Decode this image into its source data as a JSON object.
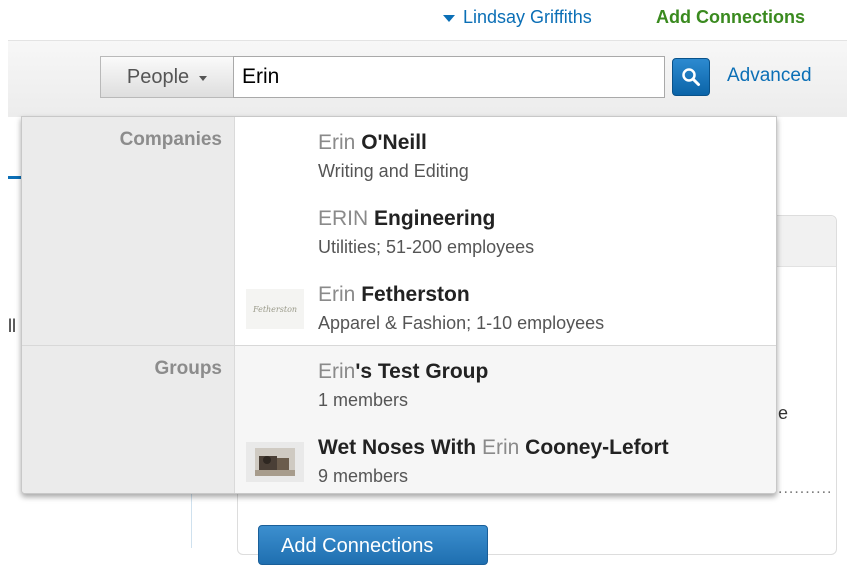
{
  "header": {
    "user_name": "Lindsay Griffiths",
    "add_connections": "Add Connections"
  },
  "search": {
    "scope_label": "People",
    "query": "Erin",
    "advanced_label": "Advanced"
  },
  "background": {
    "add_connections_button": "Add Connections"
  },
  "dropdown": {
    "companies_label": "Companies",
    "groups_label": "Groups",
    "companies": [
      {
        "highlight": "Erin",
        "rest": " O'Neill",
        "subtitle": "Writing and Editing",
        "thumb": ""
      },
      {
        "highlight": "ERIN",
        "rest": " Engineering",
        "subtitle": "Utilities; 51-200 employees",
        "thumb": ""
      },
      {
        "highlight": "Erin",
        "rest": " Fetherston",
        "subtitle": "Apparel & Fashion; 1-10 employees",
        "thumb": "Fetherston"
      }
    ],
    "groups": [
      {
        "prefix": "",
        "highlight": "Erin",
        "rest": "'s Test Group",
        "subtitle": "1 members"
      },
      {
        "prefix": "Wet Noses With ",
        "highlight": "Erin",
        "rest": " Cooney-Lefort",
        "subtitle": "9 members"
      }
    ]
  },
  "colors": {
    "link_blue": "#0b6fb6",
    "add_green": "#3a8a1f",
    "highlight_gray": "#8a8a8a"
  },
  "icons": [
    "caret-down-icon",
    "search-icon",
    "company-logo",
    "group-logo"
  ]
}
